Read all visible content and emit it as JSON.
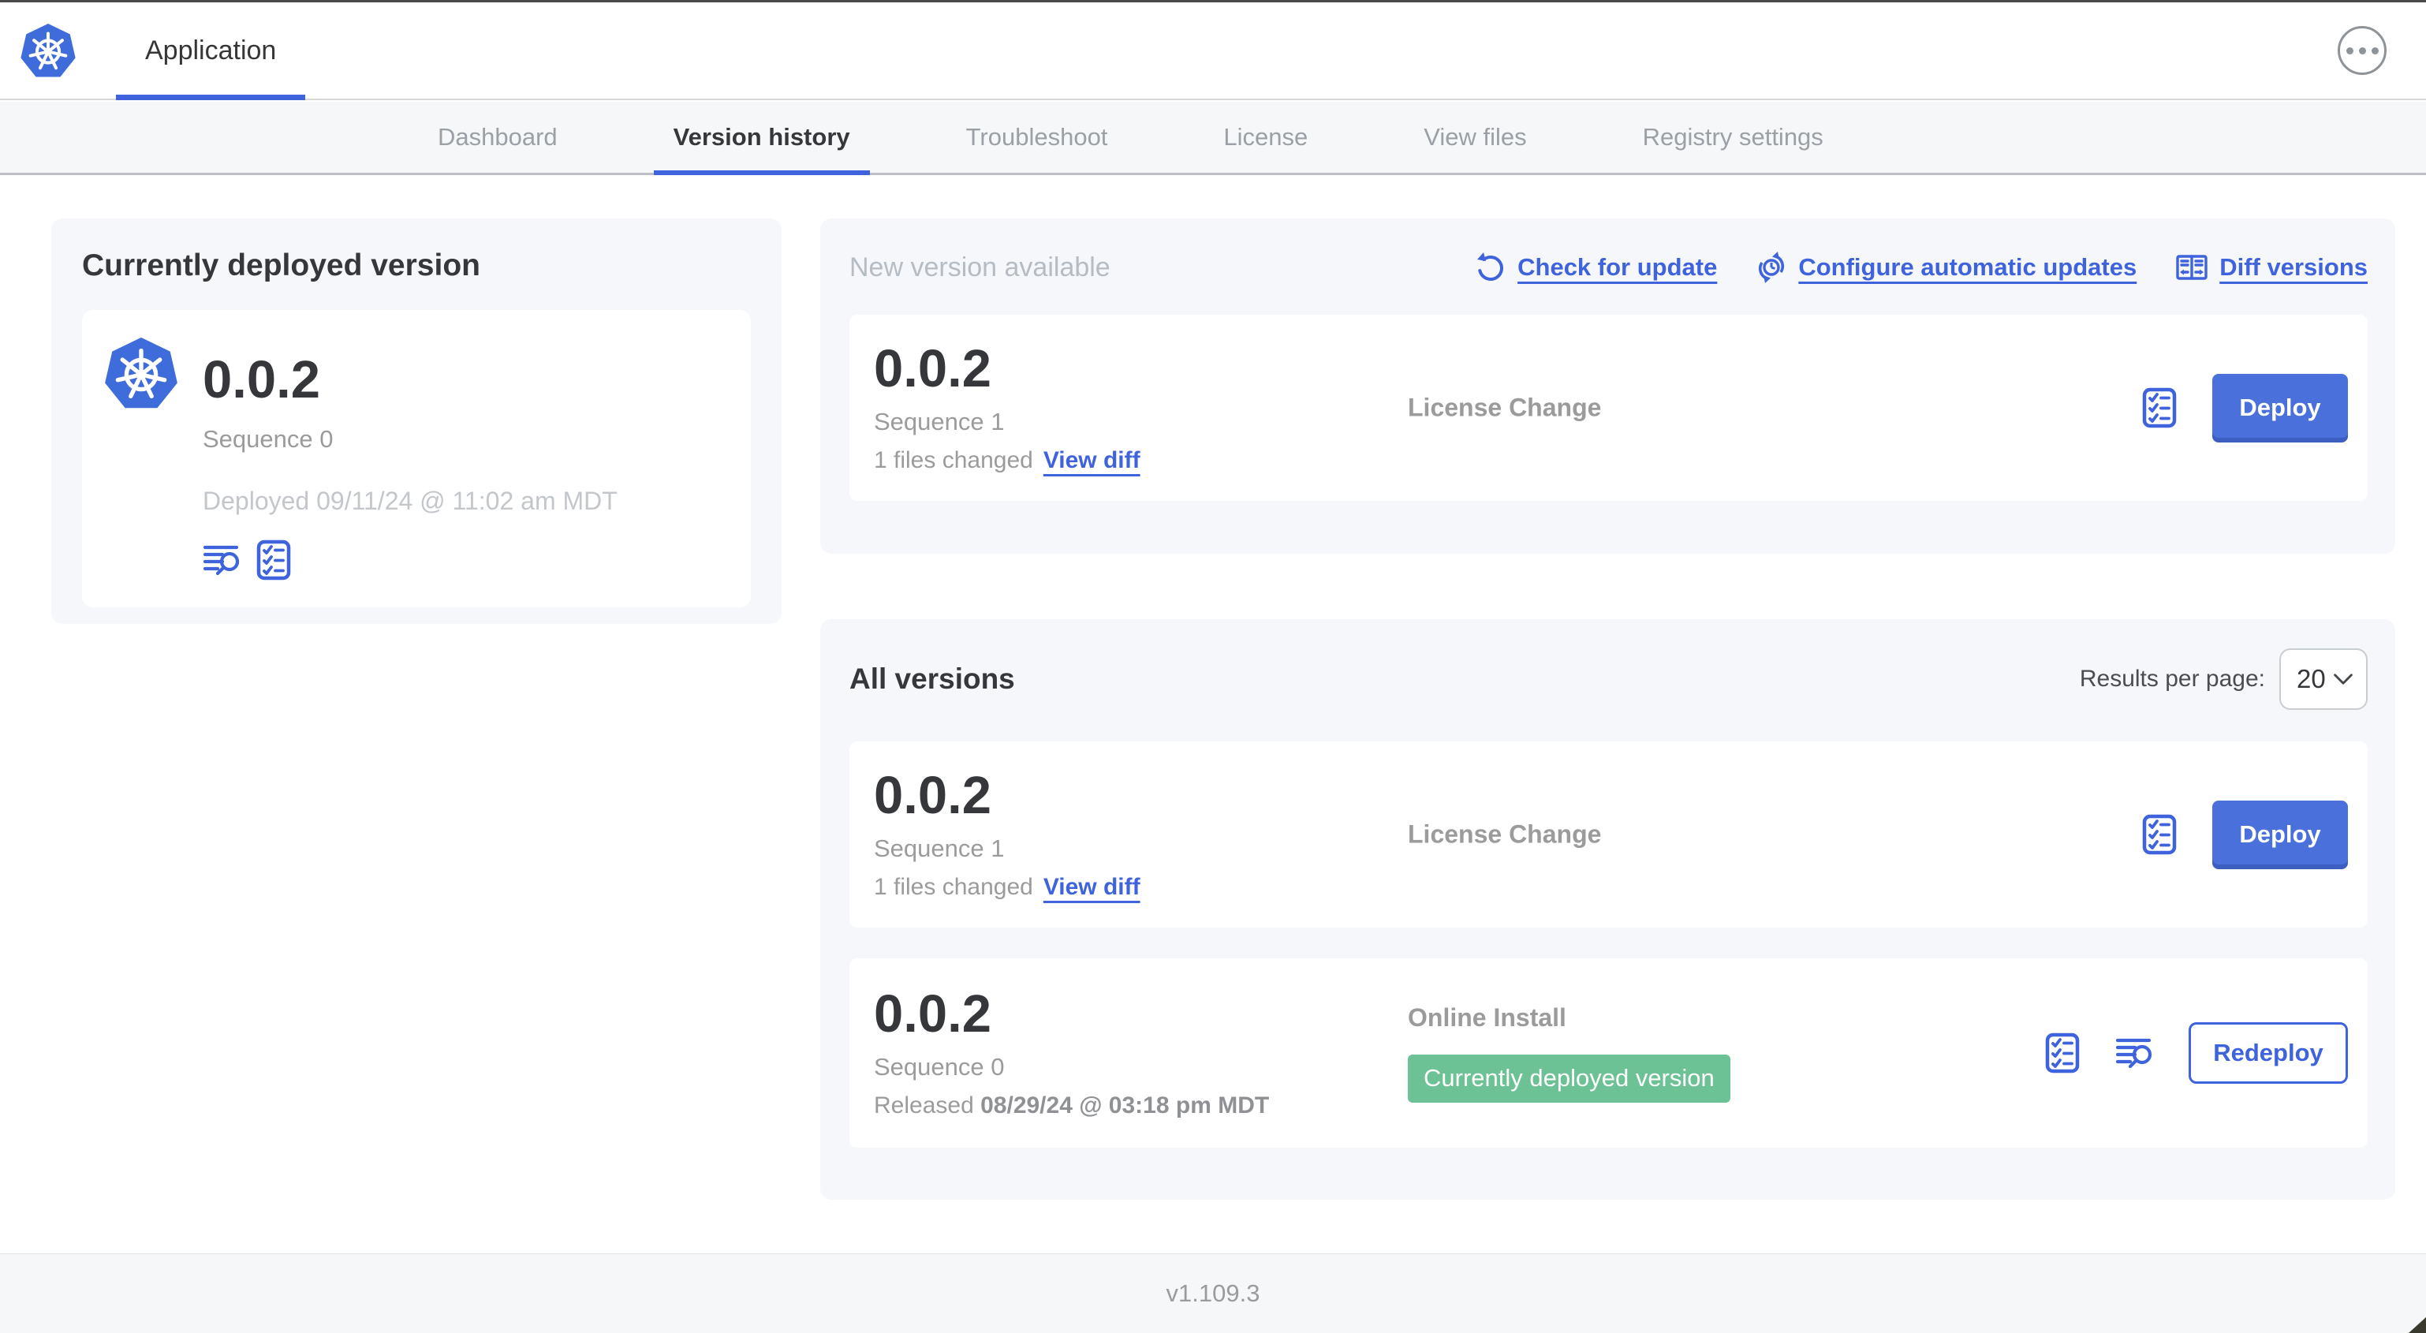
{
  "colors": {
    "accent_blue": "#3e63dc",
    "button_blue": "#4a71db",
    "kubernetes_blue": "#3f6cdb",
    "badge_green": "#6cc294",
    "section_bg": "#f5f7fa",
    "muted_text": "#9b9b9b"
  },
  "header": {
    "app_tab": "Application"
  },
  "nav": {
    "active_tab": "Version history",
    "tabs": [
      {
        "label": "Dashboard"
      },
      {
        "label": "Version history"
      },
      {
        "label": "Troubleshoot"
      },
      {
        "label": "License"
      },
      {
        "label": "View files"
      },
      {
        "label": "Registry settings"
      }
    ]
  },
  "deployed_panel": {
    "title": "Currently deployed version",
    "version": "0.0.2",
    "sequence": "Sequence 0",
    "deployed_at": "Deployed 09/11/24 @ 11:02 am MDT"
  },
  "new_version": {
    "title": "New version available",
    "check_for_update": "Check for update",
    "configure_auto_updates": "Configure automatic updates",
    "diff_versions": "Diff versions",
    "card": {
      "version": "0.0.2",
      "sequence": "Sequence 1",
      "files_changed": "1 files changed",
      "view_diff": "View diff",
      "source": "License Change",
      "deploy": "Deploy"
    }
  },
  "all_versions": {
    "title": "All versions",
    "results_per_page_label": "Results per page:",
    "results_per_page_value": "20",
    "rows": [
      {
        "version": "0.0.2",
        "sequence": "Sequence 1",
        "files_changed": "1 files changed",
        "view_diff": "View diff",
        "source": "License Change",
        "action": "Deploy"
      },
      {
        "version": "0.0.2",
        "sequence": "Sequence 0",
        "released_label": "Released",
        "released_date": "08/29/24 @ 03:18 pm MDT",
        "source": "Online Install",
        "badge": "Currently deployed version",
        "action": "Redeploy"
      }
    ]
  },
  "footer": {
    "app_version": "v1.109.3"
  }
}
